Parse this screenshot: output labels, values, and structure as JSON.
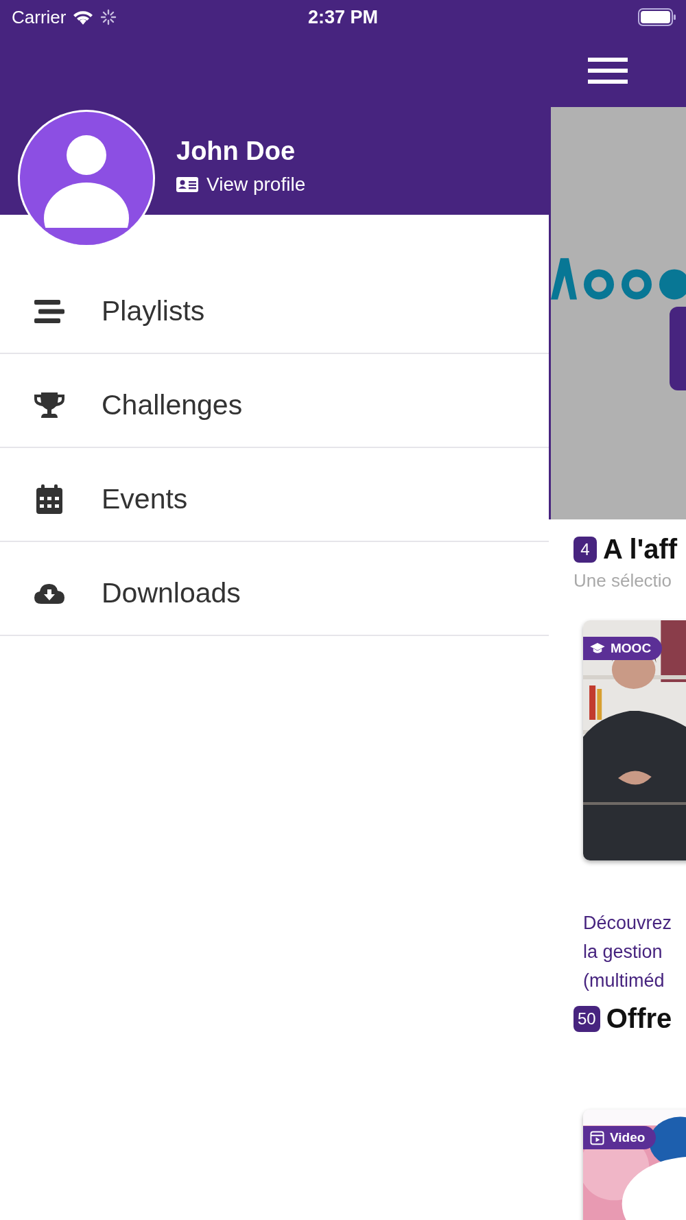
{
  "status_bar": {
    "carrier": "Carrier",
    "time": "2:37 PM"
  },
  "profile": {
    "name": "John Doe",
    "link": "View profile"
  },
  "menu": [
    {
      "label": "Playlists"
    },
    {
      "label": "Challenges"
    },
    {
      "label": "Events"
    },
    {
      "label": "Downloads"
    }
  ],
  "sections": [
    {
      "count": "4",
      "title": "A l'aff",
      "subtitle": "Une sélectio",
      "cards": [
        {
          "tag": "MOOC",
          "kind": "mooc",
          "title_lines": [
            "Découvrez",
            "la gestion",
            "(multiméd"
          ]
        }
      ]
    },
    {
      "count": "50",
      "title": "Offre",
      "cards": [
        {
          "tag": "Video",
          "kind": "video"
        }
      ]
    }
  ]
}
